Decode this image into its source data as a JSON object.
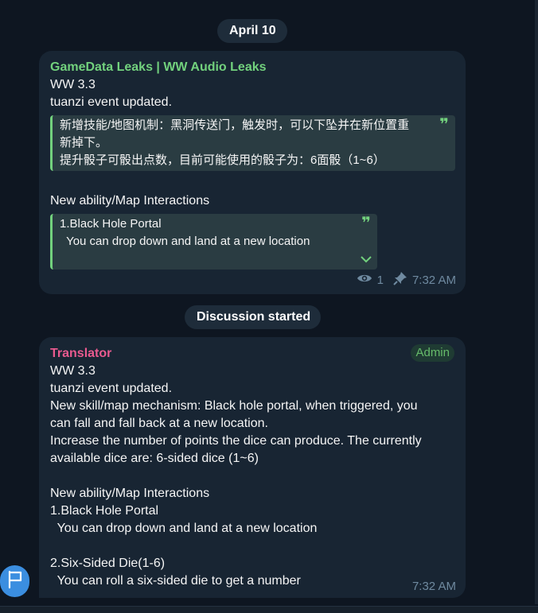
{
  "date_divider": "April 10",
  "channel_post": {
    "channel_name": "GameData Leaks | WW Audio Leaks",
    "line1": "WW 3.3",
    "line2": "tuanzi event updated.",
    "quote1_line1": "新增技能/地图机制：黑洞传送门，触发时，可以下坠并在新位置重",
    "quote1_line2": "新掉下。",
    "quote1_line3": "提升骰子可骰出点数，目前可能使用的骰子为：6面骰（1~6）",
    "line3": "New ability/Map Interactions",
    "quote2_line1": "1.Black Hole Portal",
    "quote2_line2": "  You can drop down and land at a new location",
    "views": "1",
    "time": "7:32 AM"
  },
  "discussion_divider": "Discussion started",
  "reply_post": {
    "author_name": "Translator",
    "badge": "Admin",
    "lines": [
      "WW 3.3",
      "tuanzi event updated.",
      "New skill/map mechanism: Black hole portal, when triggered, you",
      "can fall and fall back at a new location.",
      "Increase the number of points the dice can produce. The currently",
      "available dice are: 6-sided dice (1~6)",
      "",
      "New ability/Map Interactions",
      "1.Black Hole Portal",
      "  You can drop down and land at a new location",
      "",
      "2.Six-Sided Die(1-6)",
      "  You can roll a six-sided die to get a number"
    ],
    "time": "7:32 AM"
  },
  "icons": {
    "views": "eye-icon",
    "pin": "pin-icon",
    "quote": "quote-icon",
    "expand": "chevron-down-icon",
    "fab": "flag-icon"
  },
  "colors": {
    "background": "#0e1621",
    "bubble": "#182533",
    "channel_name": "#72d17d",
    "author_name": "#e95a8f",
    "admin_badge": "#66bb6a",
    "meta": "#6f8aa0",
    "fab": "#3b8ee0"
  }
}
